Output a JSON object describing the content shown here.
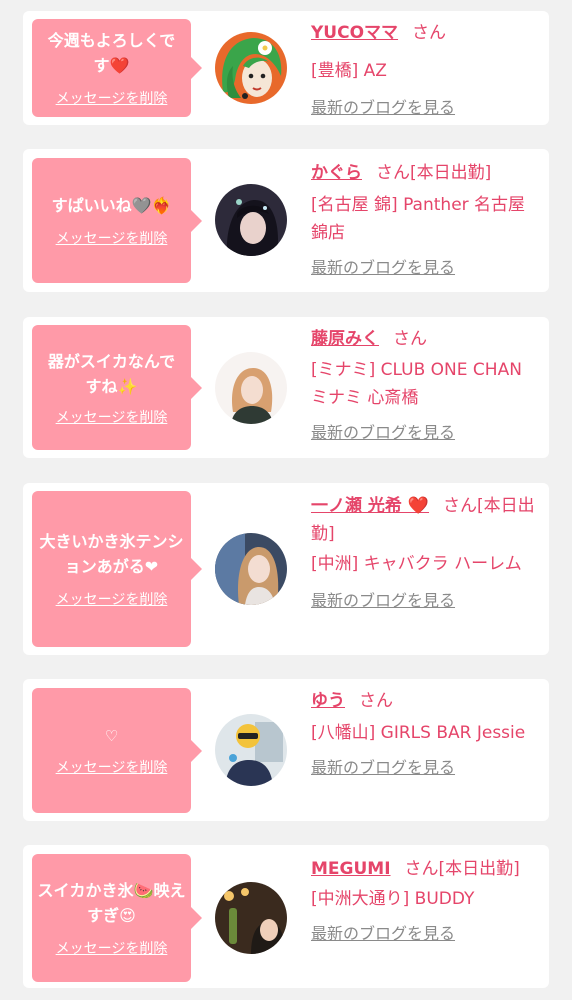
{
  "messages": [
    {
      "message": "今週もよろしくです❤️",
      "delete_label": "メッセージを削除",
      "name": "YUCOママ",
      "suffix": "さん",
      "attendance": "",
      "shop": "[豊橋] AZ",
      "blog_label": "最新のブログを見る",
      "avatar_icon": "avatar-illustration-green-hair-icon"
    },
    {
      "message": "すぱいいね🩶❤️‍🔥",
      "delete_label": "メッセージを削除",
      "name": "かぐら",
      "suffix": "さん",
      "attendance": "[本日出勤]",
      "shop": "[名古屋 錦] Panther 名古屋錦店",
      "blog_label": "最新のブログを見る",
      "avatar_icon": "avatar-photo-icon"
    },
    {
      "message": "器がスイカなんですね✨",
      "delete_label": "メッセージを削除",
      "name": "藤原みく",
      "suffix": "さん",
      "attendance": "",
      "shop": "[ミナミ] CLUB ONE CHAN ミナミ 心斎橋",
      "blog_label": "最新のブログを見る",
      "avatar_icon": "avatar-photo-icon"
    },
    {
      "message": "大きいかき氷テンションあがる❤",
      "delete_label": "メッセージを削除",
      "name": "一ノ瀬 光希 ❤️",
      "suffix": "さん",
      "attendance": "[本日出勤]",
      "shop": "[中洲] キャバクラ ハーレム",
      "blog_label": "最新のブログを見る",
      "avatar_icon": "avatar-photo-icon"
    },
    {
      "message": "♡",
      "delete_label": "メッセージを削除",
      "name": "ゆう",
      "suffix": "さん",
      "attendance": "",
      "shop": "[八幡山] GIRLS BAR Jessie",
      "blog_label": "最新のブログを見る",
      "avatar_icon": "avatar-photo-sunglasses-icon"
    },
    {
      "message": "スイカかき氷🍉映えすぎ😍",
      "delete_label": "メッセージを削除",
      "name": "MEGUMI",
      "suffix": "さん",
      "attendance": "[本日出勤]",
      "shop": "[中洲大通り] BUDDY",
      "blog_label": "最新のブログを見る",
      "avatar_icon": "avatar-photo-icon"
    }
  ],
  "colors": {
    "page_background": "#f1f1f1",
    "card_background": "#ffffff",
    "bubble_pink": "#ff9aa8",
    "name_pink": "#e5456a",
    "blog_gray": "#8a8a8a"
  }
}
